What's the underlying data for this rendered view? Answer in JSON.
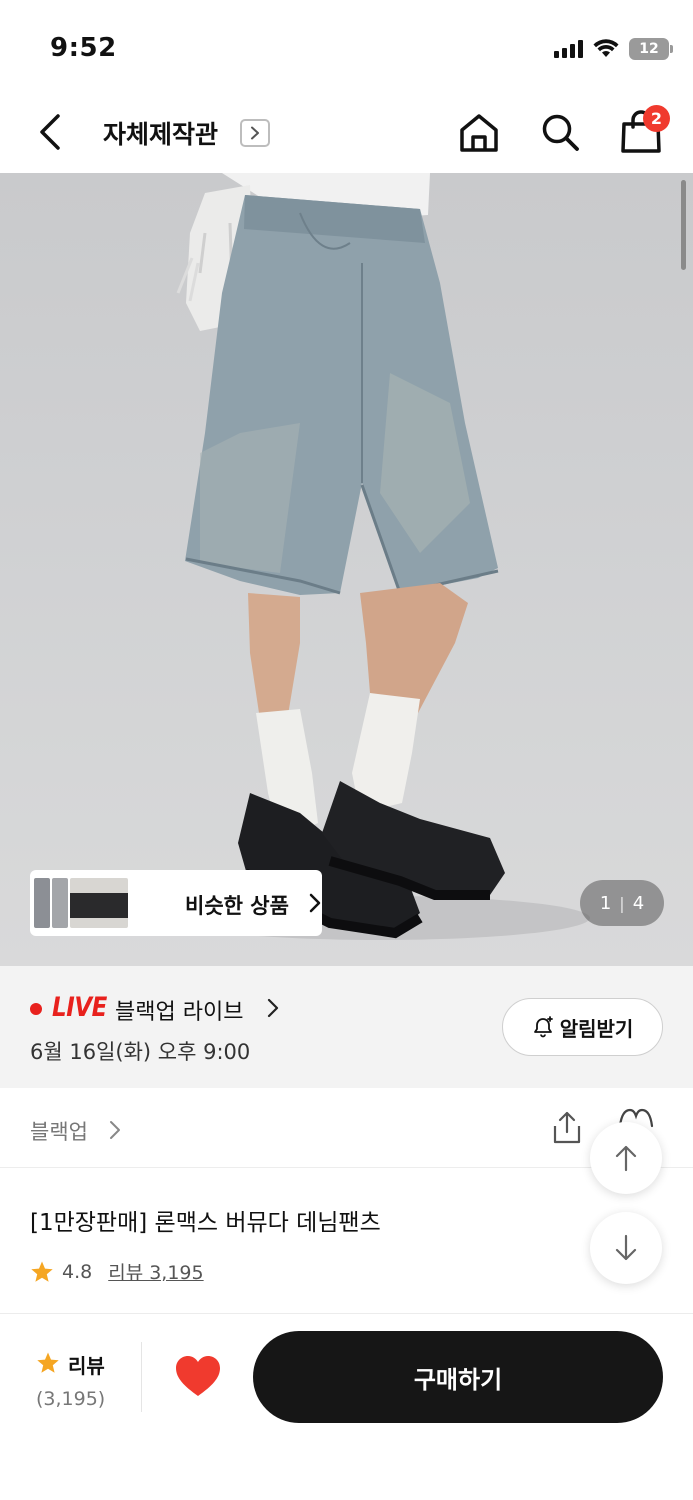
{
  "status_bar": {
    "time": "9:52",
    "battery": "12"
  },
  "nav": {
    "title": "자체제작관",
    "cart_count": "2"
  },
  "product_image": {
    "similar_label": "비슷한 상품",
    "current_page": "1",
    "separator": "|",
    "total_pages": "4"
  },
  "live": {
    "tag": "LIVE",
    "title": "블랙업 라이브",
    "datetime": "6월 16일(화) 오후 9:00",
    "alert_label": "알림받기"
  },
  "brand": {
    "name": "블랙업"
  },
  "product": {
    "title": "[1만장판매] 론맥스 버뮤다 데님팬츠",
    "rating": "4.8",
    "review_label": "리뷰 3,195"
  },
  "bottom_bar": {
    "review_label": "리뷰",
    "review_count": "(3,195)",
    "buy_label": "구매하기"
  },
  "colors": {
    "accent_red": "#e8211d",
    "badge_red": "#f03a2e",
    "star": "#f5a623",
    "heart": "#f03a2e",
    "buy_button": "#161616"
  }
}
